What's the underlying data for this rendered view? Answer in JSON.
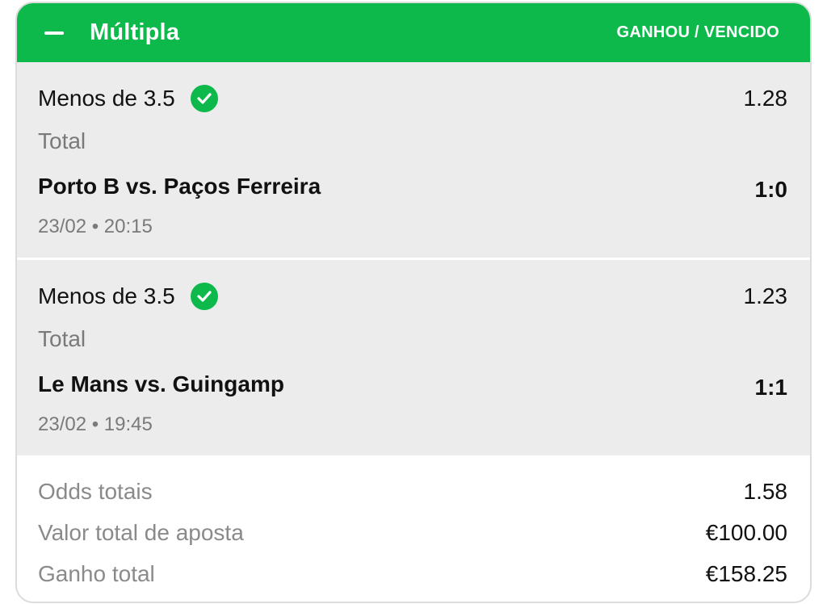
{
  "header": {
    "title": "Múltipla",
    "status": "GANHOU / VENCIDO",
    "accent_color": "#0cb94a",
    "collapse_icon": "minus-icon"
  },
  "legs": [
    {
      "selection": "Menos de 3.5",
      "status_icon": "check-circle-icon",
      "odds": "1.28",
      "market": "Total",
      "match": "Porto B vs. Paços Ferreira",
      "score": "1:0",
      "datetime": "23/02 • 20:15"
    },
    {
      "selection": "Menos de 3.5",
      "status_icon": "check-circle-icon",
      "odds": "1.23",
      "market": "Total",
      "match": "Le Mans vs. Guingamp",
      "score": "1:1",
      "datetime": "23/02 • 19:45"
    }
  ],
  "summary": {
    "total_odds_label": "Odds totais",
    "total_odds_value": "1.58",
    "stake_label": "Valor total de aposta",
    "stake_value": "€100.00",
    "payout_label": "Ganho total",
    "payout_value": "€158.25"
  }
}
